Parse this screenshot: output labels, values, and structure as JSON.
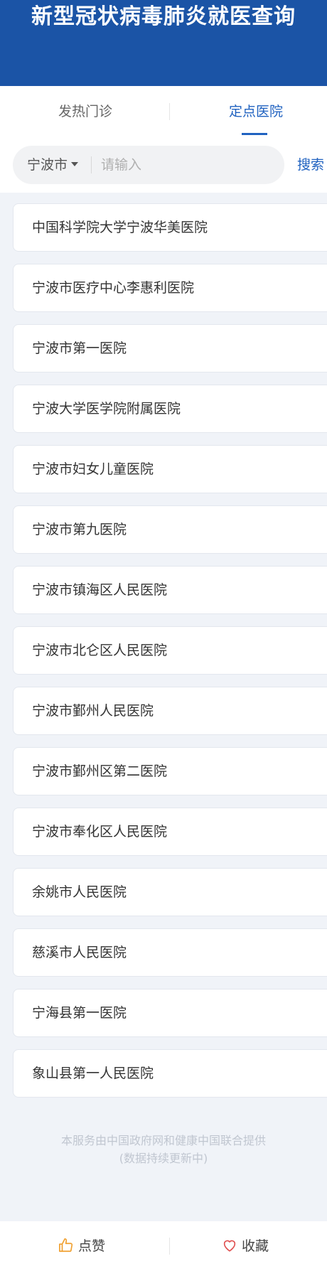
{
  "header": {
    "title": "新型冠状病毒肺炎就医查询"
  },
  "tabs": [
    {
      "label": "发热门诊",
      "active": false
    },
    {
      "label": "定点医院",
      "active": true
    }
  ],
  "search": {
    "city": "宁波市",
    "placeholder": "请输入",
    "value": "",
    "button_label": "搜索"
  },
  "hospitals": [
    {
      "name": "中国科学院大学宁波华美医院"
    },
    {
      "name": "宁波市医疗中心李惠利医院"
    },
    {
      "name": "宁波市第一医院"
    },
    {
      "name": "宁波大学医学院附属医院"
    },
    {
      "name": "宁波市妇女儿童医院"
    },
    {
      "name": "宁波市第九医院"
    },
    {
      "name": "宁波市镇海区人民医院"
    },
    {
      "name": "宁波市北仑区人民医院"
    },
    {
      "name": "宁波市鄞州人民医院"
    },
    {
      "name": "宁波市鄞州区第二医院"
    },
    {
      "name": "宁波市奉化区人民医院"
    },
    {
      "name": "余姚市人民医院"
    },
    {
      "name": "慈溪市人民医院"
    },
    {
      "name": "宁海县第一医院"
    },
    {
      "name": "象山县第一人民医院"
    }
  ],
  "notice": {
    "line1": "本服务由中国政府网和健康中国联合提供",
    "line2": "(数据持续更新中)"
  },
  "bottom_bar": {
    "like_label": "点赞",
    "like_icon": "thumbs-up-icon",
    "favorite_label": "收藏",
    "favorite_icon": "heart-icon"
  },
  "colors": {
    "header_bg": "#1b54a6",
    "accent": "#2062c0",
    "like_icon": "#f0a030",
    "favorite_icon": "#e05050"
  }
}
